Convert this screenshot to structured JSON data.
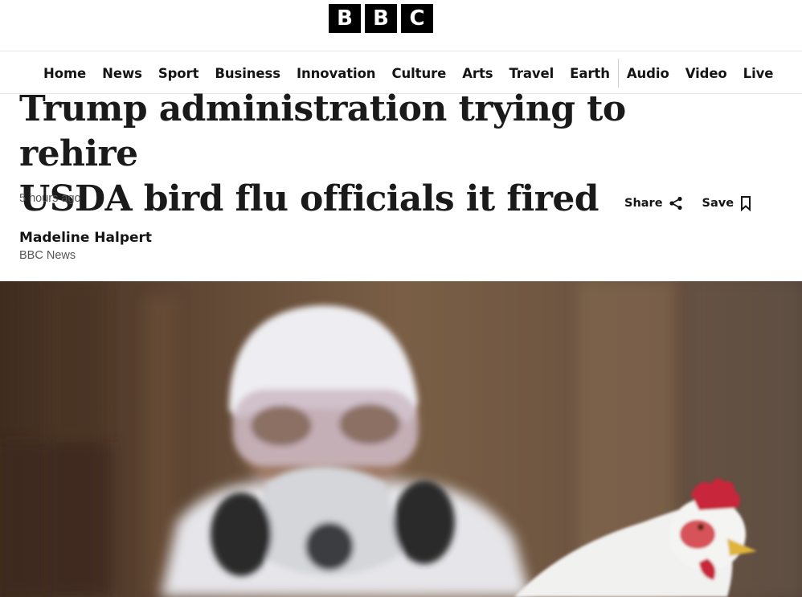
{
  "brand": {
    "letters": [
      "B",
      "B",
      "C"
    ]
  },
  "nav": {
    "items": [
      "Home",
      "News",
      "Sport",
      "Business",
      "Innovation",
      "Culture",
      "Arts",
      "Travel",
      "Earth"
    ],
    "media_items": [
      "Audio",
      "Video",
      "Live"
    ]
  },
  "article": {
    "headline_line1": "Trump administration trying to rehire",
    "headline_line2": "USDA bird flu officials it fired",
    "timestamp": "5 hours ago",
    "author": "Madeline Halpert",
    "source": "BBC News"
  },
  "actions": {
    "share_label": "Share",
    "share_icon": "share-icon",
    "save_label": "Save",
    "save_icon": "bookmark-icon"
  },
  "hero": {
    "description_icon": "hero-photo",
    "colors": {
      "background": "#5e4633",
      "suit": "#e9e9ec",
      "comb": "#c8283a"
    }
  }
}
